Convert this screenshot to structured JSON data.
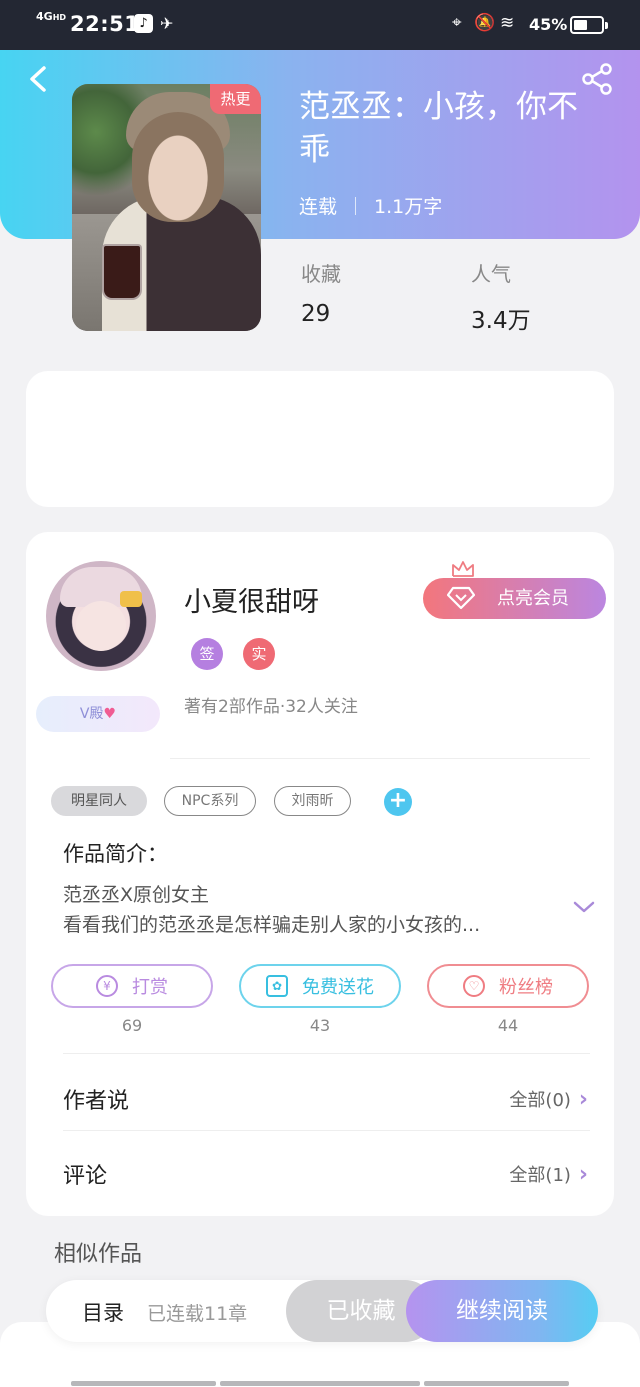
{
  "status_bar": {
    "network": "4G",
    "network_sup": "HD",
    "time": "22:51",
    "battery": "45%"
  },
  "header": {
    "hot_tag": "热更",
    "title": "范丞丞：小孩，你不乖",
    "status": "连载",
    "word_count": "1.1万字"
  },
  "stats": [
    {
      "label": "收藏",
      "value": "29"
    },
    {
      "label": "人气",
      "value": "3.4万"
    }
  ],
  "author": {
    "name": "小夏很甜呀",
    "vip_badge": "V殿",
    "badges": [
      {
        "label": "签",
        "color": "#b57fe0"
      },
      {
        "label": "实",
        "color": "#ef6a74"
      }
    ],
    "summary": "著有2部作品·32人关注",
    "vip_button": "点亮会员"
  },
  "tags": [
    "明星同人",
    "NPC系列",
    "刘雨昕"
  ],
  "intro": {
    "heading": "作品简介：",
    "line1": "范丞丞X原创女主",
    "line2": "看看我们的范丞丞是怎样骗走别人家的小女孩的..."
  },
  "actions": [
    {
      "label": "打赏",
      "icon": "¥",
      "count": "69",
      "color": "#b98be0"
    },
    {
      "label": "免费送花",
      "icon": "✿",
      "count": "43",
      "color": "#49c8e6"
    },
    {
      "label": "粉丝榜",
      "icon": "♡",
      "count": "44",
      "color": "#ef7c82"
    }
  ],
  "rows": [
    {
      "label": "作者说",
      "more": "全部(0)"
    },
    {
      "label": "评论",
      "more": "全部(1)"
    }
  ],
  "similar": "相似作品",
  "bottom": {
    "toc": "目录",
    "chapters": "已连载11章",
    "saved": "已收藏",
    "read": "继续阅读"
  }
}
